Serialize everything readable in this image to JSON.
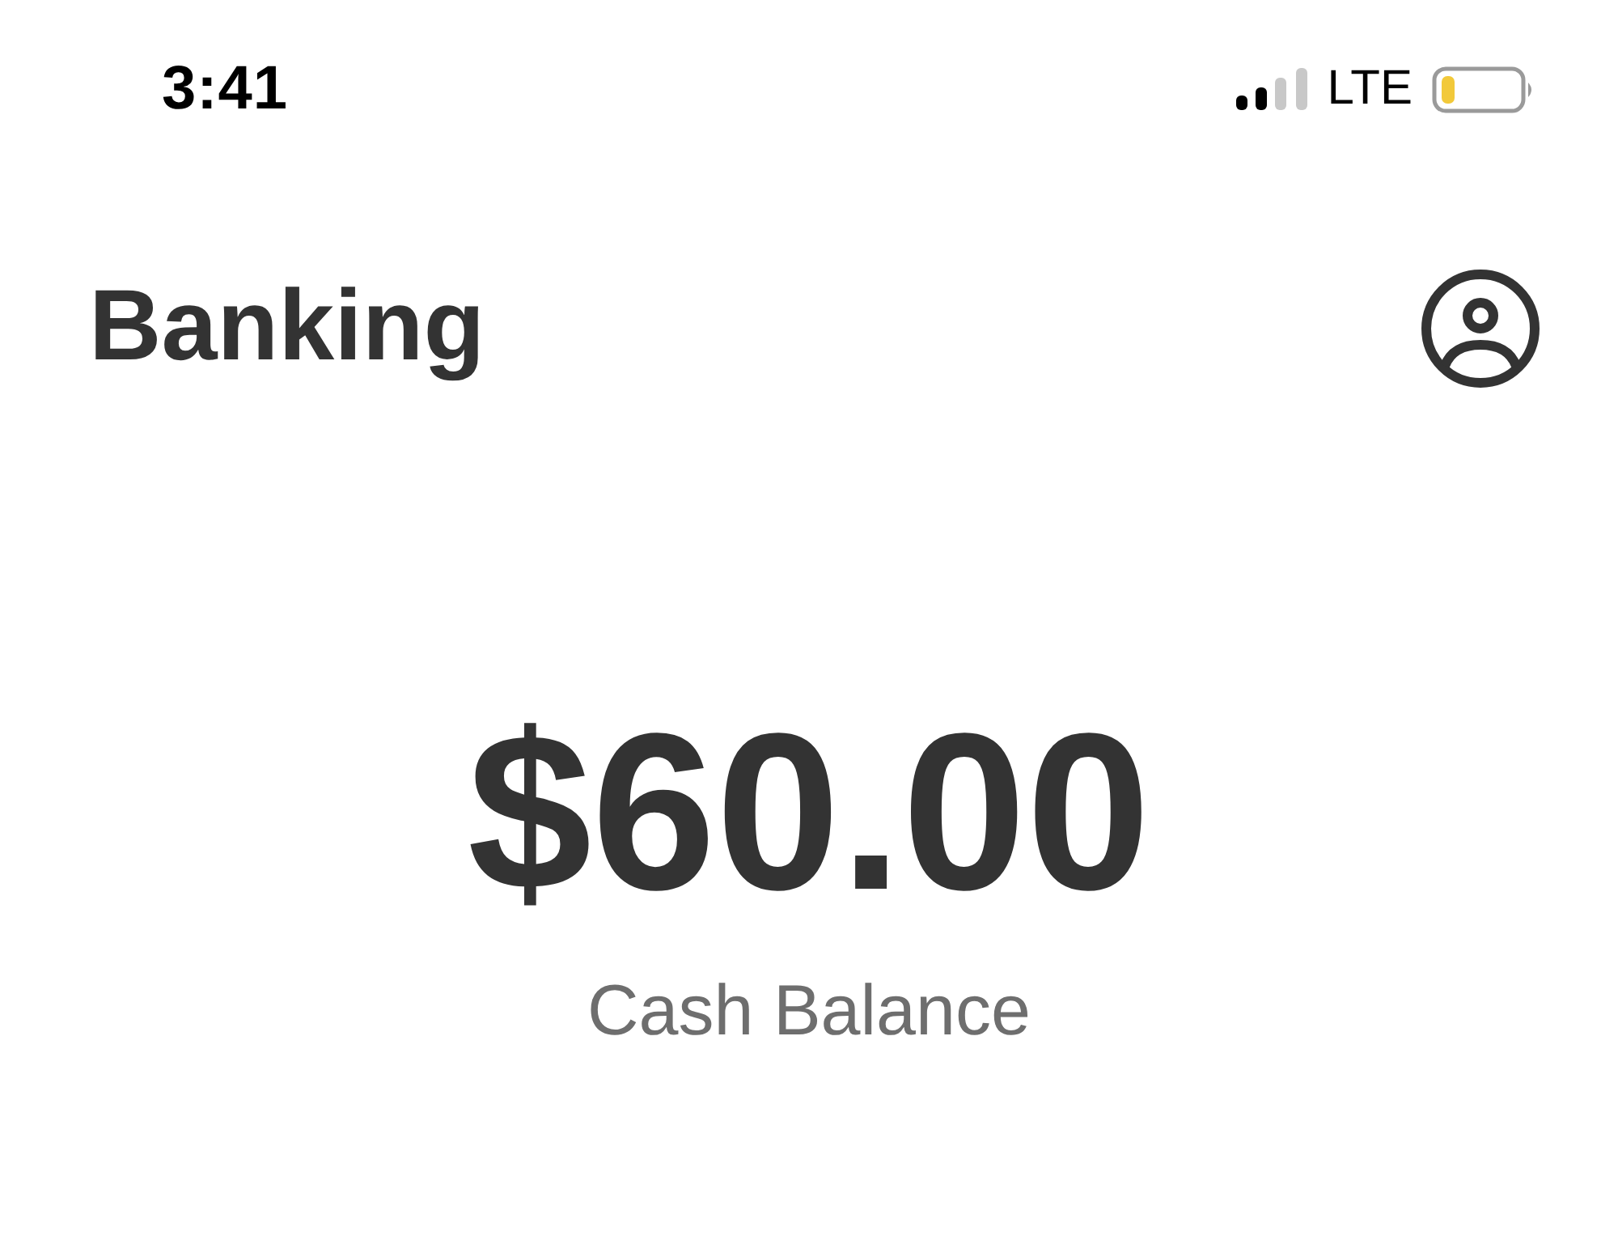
{
  "status_bar": {
    "time": "3:41",
    "network": "LTE"
  },
  "header": {
    "title": "Banking"
  },
  "balance": {
    "amount": "$60.00",
    "label": "Cash Balance"
  }
}
